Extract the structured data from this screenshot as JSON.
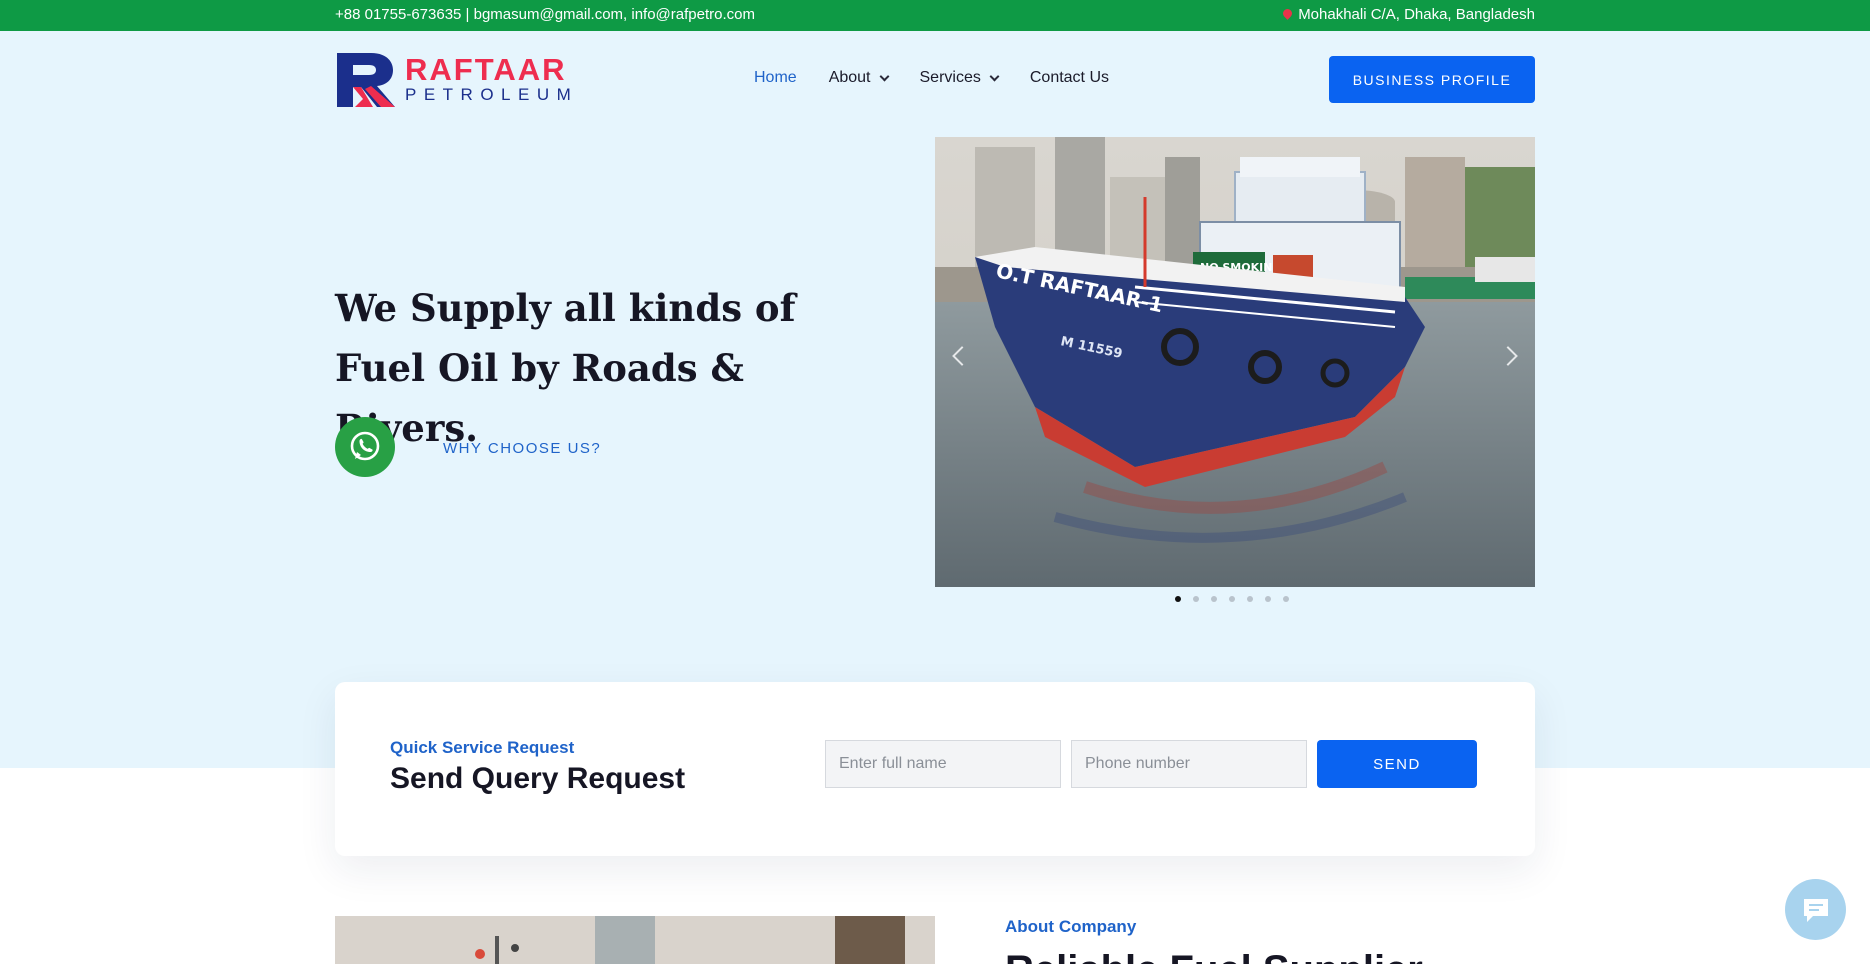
{
  "topbar": {
    "contact": "+88 01755-673635 | bgmasum@gmail.com, info@rafpetro.com",
    "address": "Mohakhali C/A, Dhaka, Bangladesh",
    "address_icon": "map-pin-icon"
  },
  "logo": {
    "name": "RAFTAAR",
    "sub": "PETROLEUM"
  },
  "nav": {
    "items": [
      {
        "label": "Home",
        "active": true
      },
      {
        "label": "About",
        "dropdown": true
      },
      {
        "label": "Services",
        "dropdown": true
      },
      {
        "label": "Contact Us"
      }
    ]
  },
  "header": {
    "cta_label": "BUSINESS PROFILE"
  },
  "hero": {
    "title": "We Supply all kinds of Fuel Oil by Roads & Rivers.",
    "whatsapp_icon": "whatsapp-icon",
    "link_label": "WHY CHOOSE US?",
    "slider": {
      "boat_name": "O.T RAFTAAR-1",
      "hull_number": "M 11559",
      "sign": "NO SMOKING SAFETY FIRST",
      "slide_count": 7,
      "active_slide": 1
    }
  },
  "query": {
    "eyebrow": "Quick Service Request",
    "title": "Send Query Request",
    "name_placeholder": "Enter full name",
    "phone_placeholder": "Phone number",
    "send_label": "SEND"
  },
  "about": {
    "eyebrow": "About Company",
    "title": "Reliable Fuel Supplier"
  },
  "colors": {
    "topbar": "#0e9a45",
    "hero_bg": "#e6f5fd",
    "accent_blue": "#0a63f1",
    "link_blue": "#1f63c9",
    "brand_red": "#ee2d4f",
    "brand_navy": "#1b2f8c"
  }
}
